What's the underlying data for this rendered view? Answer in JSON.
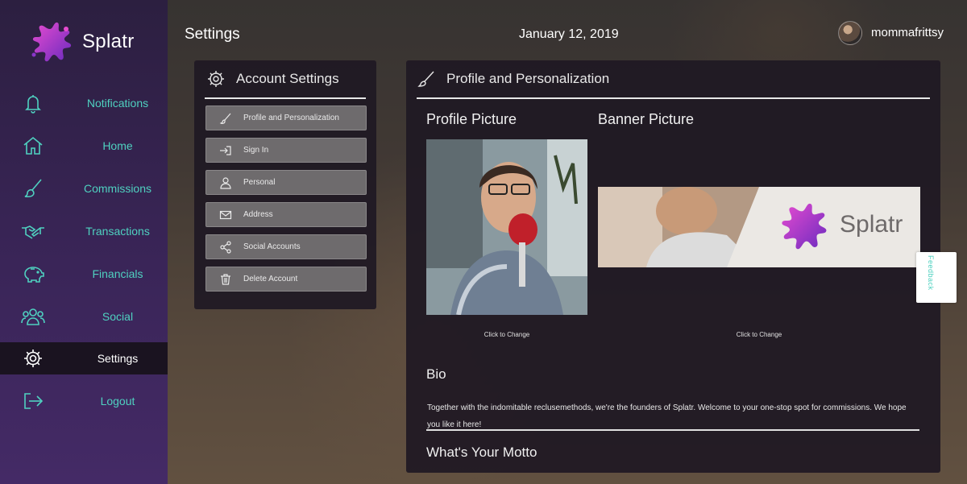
{
  "app": {
    "name": "Splatr"
  },
  "header": {
    "title": "Settings",
    "date": "January 12, 2019",
    "username": "mommafrittsy"
  },
  "sidebar": {
    "items": [
      {
        "label": "Notifications",
        "icon": "bell-icon"
      },
      {
        "label": "Home",
        "icon": "home-icon"
      },
      {
        "label": "Commissions",
        "icon": "brush-icon"
      },
      {
        "label": "Transactions",
        "icon": "handshake-icon"
      },
      {
        "label": "Financials",
        "icon": "piggy-bank-icon"
      },
      {
        "label": "Social",
        "icon": "users-icon"
      },
      {
        "label": "Settings",
        "icon": "gear-icon",
        "active": true
      },
      {
        "label": "Logout",
        "icon": "logout-icon"
      }
    ]
  },
  "account_settings": {
    "title": "Account Settings",
    "menu": [
      {
        "label": "Profile and Personalization",
        "icon": "brush-icon"
      },
      {
        "label": "Sign In",
        "icon": "sign-in-icon"
      },
      {
        "label": "Personal",
        "icon": "user-icon"
      },
      {
        "label": "Address",
        "icon": "envelope-icon"
      },
      {
        "label": "Social Accounts",
        "icon": "share-icon"
      },
      {
        "label": "Delete Account",
        "icon": "trash-icon"
      }
    ]
  },
  "profile": {
    "title": "Profile and Personalization",
    "profile_picture_label": "Profile Picture",
    "banner_picture_label": "Banner Picture",
    "profile_click": "Click to Change",
    "banner_click": "Click to Change",
    "banner_brand": "Splatr",
    "bio_title": "Bio",
    "bio_text": "Together with the indomitable reclusemethods,  we're the founders of Splatr. Welcome to your one-stop spot for commissions. We hope you like it here!",
    "motto_title": "What's Your Motto"
  },
  "feedback": {
    "label": "Feedback"
  },
  "colors": {
    "accent": "#4fd1c0",
    "sidebar_top": "#2c1f40",
    "sidebar_bottom": "#442a66",
    "panel": "#1f1924",
    "logo": "#b23fd6"
  }
}
